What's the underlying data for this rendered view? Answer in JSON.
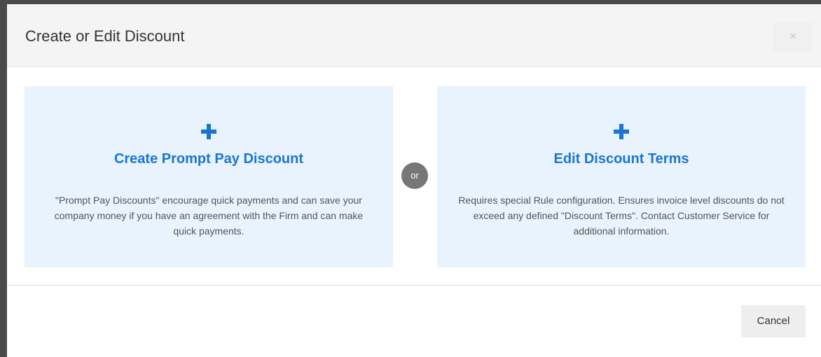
{
  "modal": {
    "title": "Create or Edit Discount",
    "close_label": "×",
    "separator_label": "or",
    "cancel_label": "Cancel"
  },
  "options": [
    {
      "icon": "plus-icon",
      "title": "Create Prompt Pay Discount",
      "description": "\"Prompt Pay Discounts\" encourage quick payments and can save your company money if you have an agreement with the Firm and can make quick payments."
    },
    {
      "icon": "plus-icon",
      "title": "Edit Discount Terms",
      "description": "Requires special Rule configuration. Ensures invoice level discounts do not exceed any defined \"Discount Terms\". Contact Customer Service for additional information."
    }
  ],
  "colors": {
    "accent": "#1a75d2",
    "card_background": "#e8f3fd",
    "separator_badge": "#777777",
    "header_background": "#f4f4f4"
  }
}
